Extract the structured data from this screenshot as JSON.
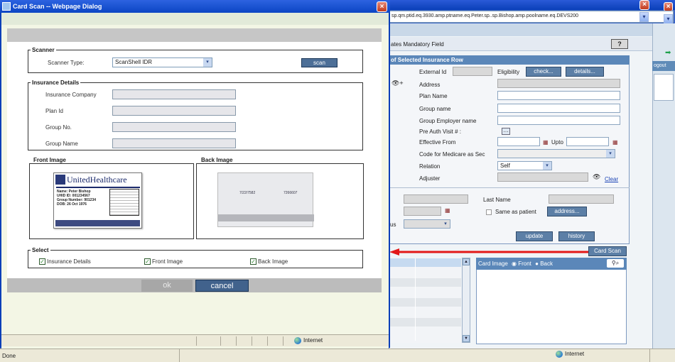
{
  "bg": {
    "address": "sp.qm.ptid.eq.3930.amp.ptname.eq.Peter.sp..sp.Bishop.amp.poolname.eq.DEVS200",
    "logout": "ogout",
    "mandatory_text": "ates Mandatory Field",
    "help_label": "?",
    "panel_title": "of Selected Insurance Row",
    "external_id_label": "External Id",
    "eligibility_label": "Eligibility",
    "check_label": "check...",
    "details_label": "details...",
    "address_label": "Address",
    "plan_name_label": "Plan Name",
    "group_name_label": "Group name",
    "group_employer_label": "Group Employer name",
    "pre_auth_label": "Pre Auth Visit # :",
    "effective_from_label": "Effective From",
    "upto_label": "Upto",
    "medicare_label": "Code for Medicare as Sec",
    "relation_label": "Relation",
    "relation_value": "Self",
    "adjuster_label": "Adjuster",
    "clear_label": "Clear",
    "last_name_label": "Last Name",
    "same_as_patient_label": "Same as patient",
    "address_btn": "address...",
    "us_label": "us",
    "update_label": "update",
    "history_label": "history",
    "card_scan_label": "Card Scan",
    "card_image_label": "Card Image",
    "front_label": "Front",
    "back_label": "Back",
    "status_done": "Done",
    "status_internet": "Internet"
  },
  "dialog": {
    "title": "Card Scan -- Webpage Dialog",
    "scanner_legend": "Scanner",
    "scanner_type_label": "Scanner Type:",
    "scanner_type_value": "ScanShell IDR",
    "scan_label": "scan",
    "insurance_legend": "Insurance Details",
    "insurance_company_label": "Insurance Company",
    "plan_id_label": "Plan Id",
    "group_no_label": "Group No.",
    "group_name_label": "Group Name",
    "front_image_label": "Front Image",
    "back_image_label": "Back Image",
    "select_legend": "Select",
    "chk_insurance_label": "Insurance Details",
    "chk_front_label": "Front Image",
    "chk_back_label": "Back Image",
    "ok_label": "ok",
    "cancel_label": "cancel",
    "status_internet": "Internet"
  },
  "card": {
    "brand": "UnitedHealthcare",
    "name_line": "Name: Peter Bishop",
    "id_line": "UHID ID: 001234567",
    "group_line": "Group Number: 901234",
    "dob_line": "DOB: 26 Oct 1976",
    "back_left": "7/22/7582",
    "back_right": "7266607"
  }
}
